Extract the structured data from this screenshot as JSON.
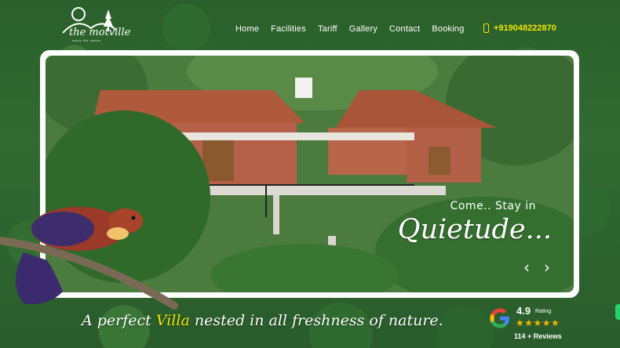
{
  "brand": {
    "name": "the motville",
    "tagline_small": "enjoy the nature"
  },
  "nav": {
    "items": [
      "Home",
      "Facilities",
      "Tariff",
      "Gallery",
      "Contact",
      "Booking"
    ]
  },
  "header": {
    "phone": "+919048222870"
  },
  "hero": {
    "caption_small": "Come.. Stay in",
    "caption_big": "Quietude...",
    "prev_label": "‹",
    "next_label": "›"
  },
  "tagline": {
    "before": "A perfect ",
    "highlight": "Villa",
    "after": " nested in all freshness of nature."
  },
  "rating": {
    "score": "4.9",
    "word": "Rating",
    "stars": "★★★★★",
    "reviews": "114 + Reviews"
  },
  "colors": {
    "accent": "#f2e600",
    "forest": "#2f6a2e",
    "star": "#f5b400"
  }
}
